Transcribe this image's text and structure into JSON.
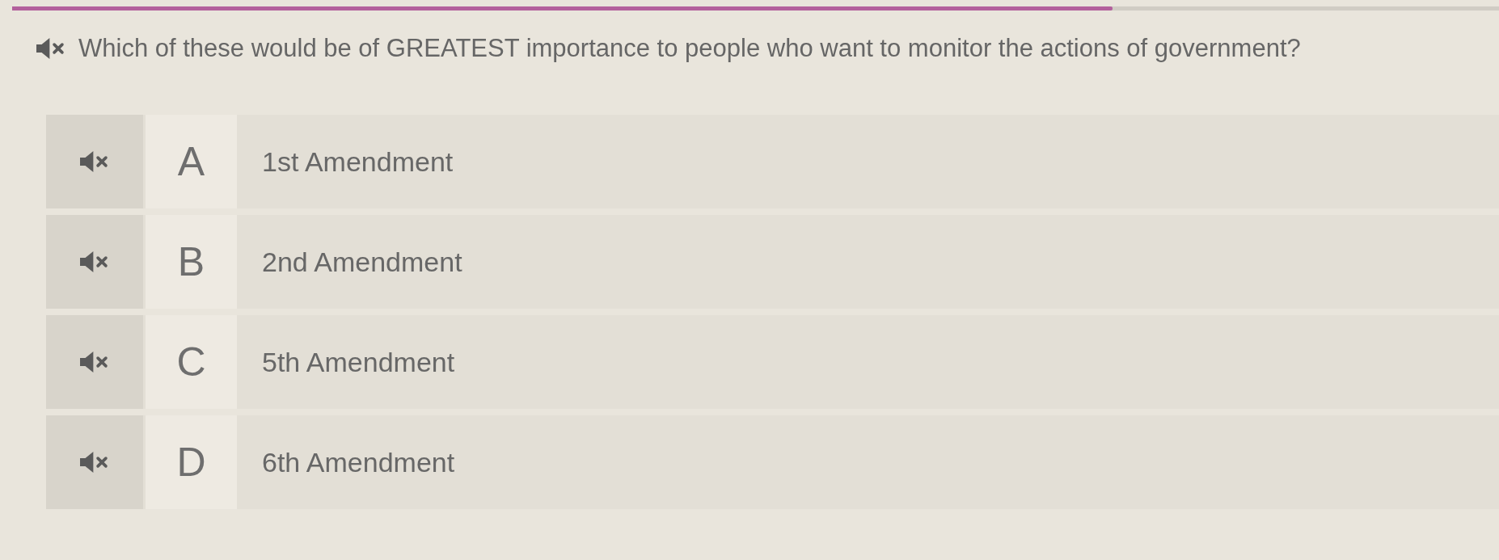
{
  "progress": {
    "level": 0.74
  },
  "question": {
    "text": "Which of these would be of GREATEST importance to people who want to monitor the actions of government?"
  },
  "options": [
    {
      "letter": "A",
      "text": "1st Amendment",
      "selected": false
    },
    {
      "letter": "B",
      "text": "2nd Amendment",
      "selected": false
    },
    {
      "letter": "C",
      "text": "5th Amendment",
      "selected": false
    },
    {
      "letter": "D",
      "text": "6th Amendment",
      "selected": false
    }
  ]
}
